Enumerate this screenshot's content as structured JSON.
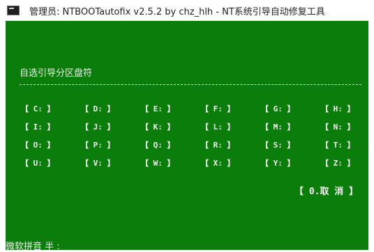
{
  "window": {
    "title": "管理员:  NTBOOTautofix v2.5.2 by chz_hlh - NT系统引导自动修复工具"
  },
  "colors": {
    "console_bg": "#0b7d0b",
    "console_fg": "#f2f2f2"
  },
  "console": {
    "heading": "自选引导分区盘符",
    "divider": "--------------------------------------------------------------------------------",
    "drives": [
      "【 C: 】",
      "【 D: 】",
      "【 E: 】",
      "【 F: 】",
      "【 G: 】",
      "【 H: 】",
      "【 I: 】",
      "【 J: 】",
      "【 K: 】",
      "【 L: 】",
      "【 M: 】",
      "【 N: 】",
      "【 O: 】",
      "【 P: 】",
      "【 Q: 】",
      "【 R: 】",
      "【 S: 】",
      "【 T: 】",
      "【 U: 】",
      "【 V: 】",
      "【 W: 】",
      "【 X: 】",
      "【 Y: 】",
      "【 Z: 】"
    ],
    "cancel": "【 0.取  消 】"
  },
  "ime_status": "微软拼音 半 :"
}
